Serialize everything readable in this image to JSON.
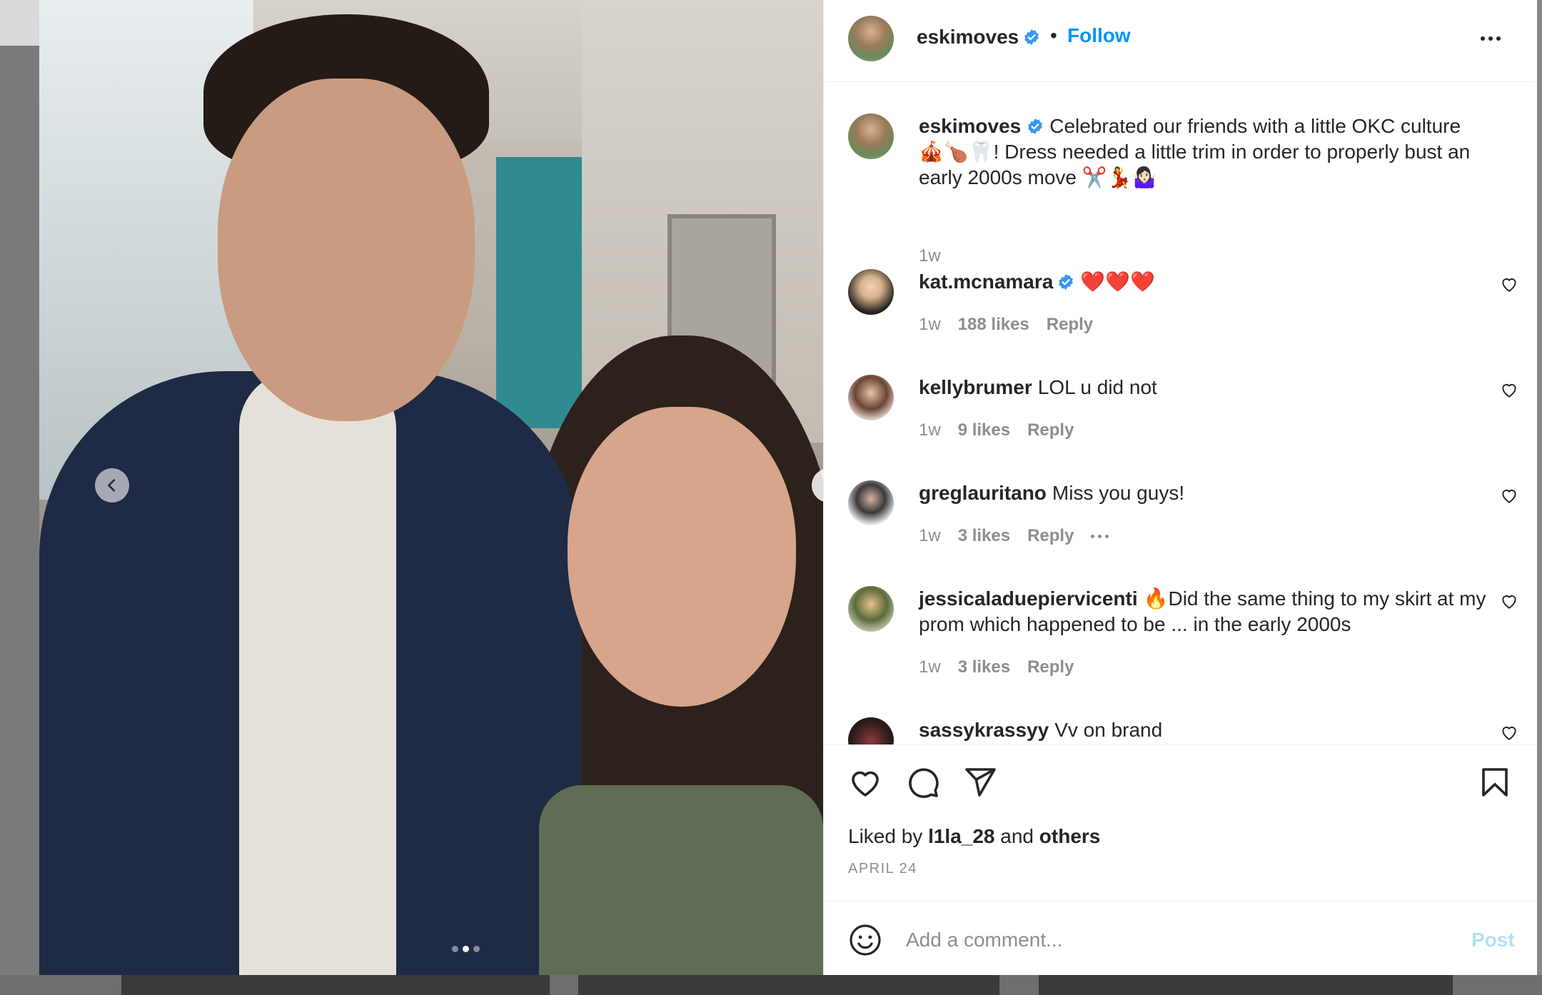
{
  "post": {
    "owner": "eskimoves",
    "follow_label": "Follow",
    "separator": "•",
    "caption": "Celebrated our friends with a little OKC culture 🎪🍗🦷! Dress needed a little trim in order to properly bust an early 2000s move ✂️💃🤷🏻‍♀️",
    "caption_time": "1w",
    "liked_by_prefix": "Liked by",
    "liked_by_user": "l1la_28",
    "liked_by_and": "and",
    "liked_by_others": "others",
    "date": "APRIL 24",
    "carousel": {
      "slide_count": 3,
      "active_index": 1
    }
  },
  "comments": [
    {
      "user": "kat.mcnamara",
      "verified": true,
      "text": "❤️❤️❤️",
      "time": "1w",
      "likes": "188 likes",
      "reply": "Reply"
    },
    {
      "user": "kellybrumer",
      "verified": false,
      "text": "LOL u did not",
      "time": "1w",
      "likes": "9 likes",
      "reply": "Reply"
    },
    {
      "user": "greglauritano",
      "verified": false,
      "text": "Miss you guys!",
      "time": "1w",
      "likes": "3 likes",
      "reply": "Reply"
    },
    {
      "user": "jessicaladuepiervicenti",
      "verified": false,
      "text": "🔥Did the same thing to my skirt at my prom which happened to be ... in the early 2000s",
      "time": "1w",
      "likes": "3 likes",
      "reply": "Reply"
    },
    {
      "user": "sassykrassyy",
      "verified": false,
      "text": "Vv on brand"
    }
  ],
  "composer": {
    "placeholder": "Add a comment...",
    "post_label": "Post"
  },
  "colors": {
    "link_blue": "#0095f6",
    "post_disabled": "#b2dffc",
    "muted_text": "#8e8e8e",
    "verified_blue": "#3897f0"
  }
}
